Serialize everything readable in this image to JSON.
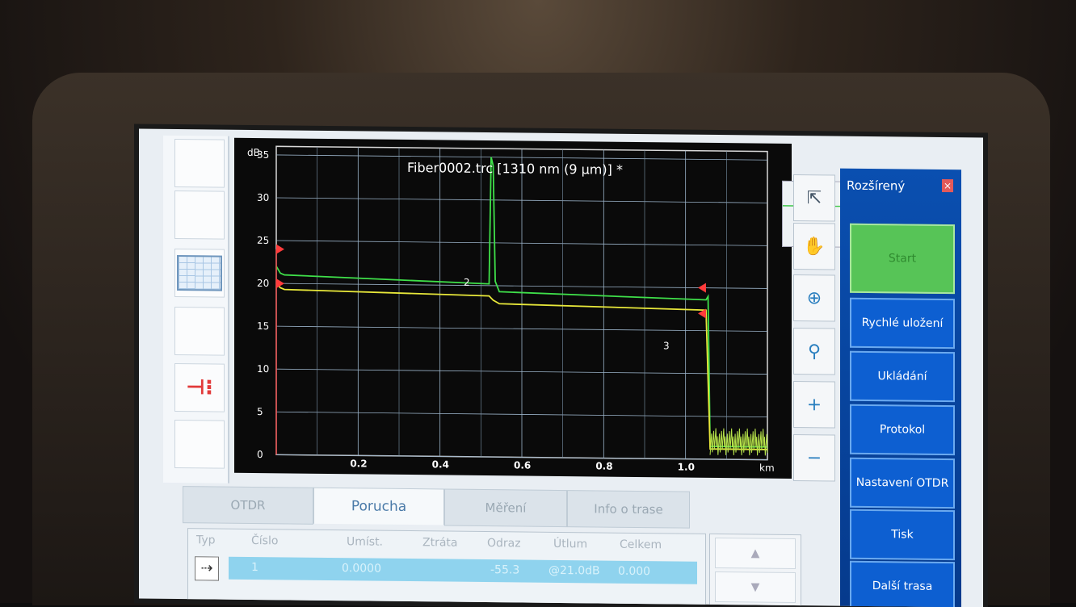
{
  "plot": {
    "title": "Fiber0002.trc [1310 nm (9 µm)] *",
    "y_unit": "dB",
    "x_unit": "km",
    "y_ticks": [
      "35",
      "30",
      "25",
      "20",
      "15",
      "10",
      "5",
      "0"
    ],
    "x_ticks": [
      "0.2",
      "0.4",
      "0.6",
      "0.8",
      "1.0"
    ],
    "event_labels": [
      "2",
      "3"
    ]
  },
  "chart_data": {
    "type": "line",
    "title": "Fiber0002.trc [1310 nm (9 µm)] *",
    "xlabel": "km",
    "ylabel": "dB",
    "xlim": [
      0,
      1.2
    ],
    "ylim": [
      0,
      36
    ],
    "grid": true,
    "series": [
      {
        "color": "#3fe04a",
        "x": [
          0.0,
          0.01,
          0.02,
          0.52,
          0.525,
          0.53,
          0.535,
          0.545,
          1.05,
          1.055,
          1.06,
          1.2
        ],
        "y": [
          22.0,
          21.2,
          21.0,
          20.2,
          35.0,
          34.0,
          20.5,
          19.3,
          18.6,
          19.0,
          1.5,
          1.5
        ]
      },
      {
        "color": "#e8e83a",
        "x": [
          0.0,
          0.01,
          0.02,
          0.52,
          0.53,
          0.545,
          1.05,
          1.06,
          1.2
        ],
        "y": [
          20.0,
          19.5,
          19.3,
          18.8,
          18.3,
          17.9,
          17.4,
          1.2,
          1.2
        ]
      }
    ],
    "markers": [
      {
        "x": 0.0,
        "y": 24.0
      },
      {
        "x": 0.0,
        "y": 20.0
      },
      {
        "x": 1.05,
        "y": 20.0
      },
      {
        "x": 1.05,
        "y": 17.0
      }
    ]
  },
  "tools": {
    "pointer": "pointer-icon",
    "hand": "hand-icon",
    "zoom_fit": "zoom-fit-icon",
    "zoom": "magnifier-icon",
    "zoom_in": "zoom-in-icon",
    "zoom_out": "zoom-out-icon"
  },
  "menu": {
    "title": "Rozšírený",
    "close": "×",
    "start": "Start",
    "quick_save": "Rychlé uložení",
    "save": "Ukládání",
    "protocol": "Protokol",
    "otdr_settings": "Nastavení OTDR",
    "print": "Tisk",
    "next_trace": "Další trasa"
  },
  "tabs": [
    "OTDR",
    "Porucha",
    "Měření",
    "Info o trase"
  ],
  "table": {
    "headers": [
      "Typ",
      "Číslo",
      "Umíst.",
      "Ztráta",
      "Odraz",
      "Útlum",
      "Celkem"
    ],
    "rows": [
      {
        "number": "1",
        "location": "0.0000",
        "loss": "",
        "reflection": "-55.3",
        "attenuation": "@21.0dB",
        "total": "0.000"
      }
    ]
  },
  "colors": {
    "menu_blue": "#0a4fb0",
    "start_green": "#57c457",
    "trace_green": "#3fe04a",
    "trace_yellow": "#e8e83a",
    "marker_red": "#ff3b3b"
  }
}
